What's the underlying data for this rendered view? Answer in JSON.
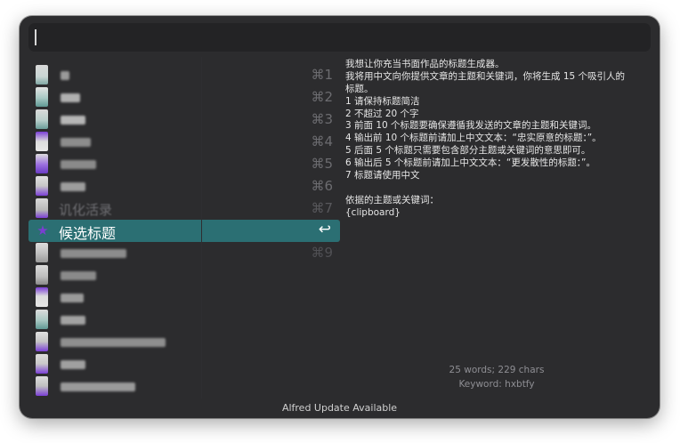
{
  "search": {
    "query": ""
  },
  "results": {
    "shortcuts": [
      "⌘1",
      "⌘2",
      "⌘3",
      "⌘4",
      "⌘5",
      "⌘6",
      "⌘7",
      "",
      "⌘9"
    ],
    "partial_item_label": "讥化活录",
    "selected": {
      "title": "候选标题",
      "action_icon": "return-key-icon",
      "action_glyph": "↩"
    }
  },
  "preview": {
    "lines": [
      "我想让你充当书面作品的标题生成器。",
      "我将用中文向你提供文章的主题和关键词，你将生成 15 个吸引人的",
      "标题。",
      "1 请保持标题简洁",
      "2 不超过 20 个字",
      "3 前面 10 个标题要确保遵循我发送的文章的主题和关键词。",
      "4 输出前 10 个标题前请加上中文文本：“忠实原意的标题：”。",
      "5 后面 5 个标题只需要包含部分主题或关键词的意思即可。",
      "6 输出后 5 个标题前请加上中文文本：“更发散性的标题：”。",
      "7 标题请使用中文",
      "",
      "依据的主题或关键词：",
      "{clipboard}"
    ],
    "stats": "25 words; 229 chars",
    "keyword": "Keyword: hxbtfy"
  },
  "footer": {
    "status": "Alfred Update Available"
  },
  "colors": {
    "window_bg": "#2c2c2e",
    "selection": "#2b6f73",
    "icon_accent": "#7a3fd0"
  }
}
